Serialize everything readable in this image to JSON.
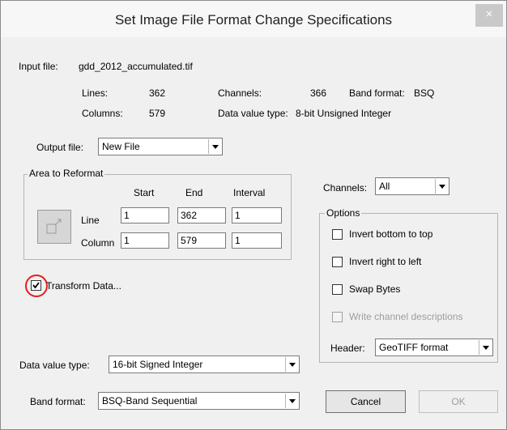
{
  "window": {
    "title": "Set Image File Format Change Specifications",
    "close_glyph": "×"
  },
  "input_file": {
    "label": "Input file:",
    "value": "gdd_2012_accumulated.tif"
  },
  "info": {
    "lines_label": "Lines:",
    "lines_value": "362",
    "columns_label": "Columns:",
    "columns_value": "579",
    "channels_label": "Channels:",
    "channels_value": "366",
    "band_format_label": "Band format:",
    "band_format_value": "BSQ",
    "data_value_type_label": "Data value type:",
    "data_value_type_value": "8-bit Unsigned Integer"
  },
  "output_file": {
    "label": "Output file:",
    "selected": "New File"
  },
  "area": {
    "group_label": "Area to Reformat",
    "col_start": "Start",
    "col_end": "End",
    "col_interval": "Interval",
    "line_label": "Line",
    "line_start": "1",
    "line_end": "362",
    "line_interval": "1",
    "column_label": "Column",
    "column_start": "1",
    "column_end": "579",
    "column_interval": "1"
  },
  "transform": {
    "label": "Transform Data...",
    "checked": true,
    "highlight_color": "#e02020"
  },
  "channels": {
    "label": "Channels:",
    "selected": "All"
  },
  "options": {
    "group_label": "Options",
    "invert_bottom_to_top": {
      "label": "Invert bottom to top",
      "checked": false
    },
    "invert_right_to_left": {
      "label": "Invert right to left",
      "checked": false
    },
    "swap_bytes": {
      "label": "Swap Bytes",
      "checked": false
    },
    "write_channel_descriptions": {
      "label": "Write channel descriptions",
      "checked": false,
      "enabled": false
    },
    "header_label": "Header:",
    "header_selected": "GeoTIFF format"
  },
  "data_value_type": {
    "label": "Data value type:",
    "selected": "16-bit Signed Integer"
  },
  "band_format": {
    "label": "Band format:",
    "selected": "BSQ-Band Sequential"
  },
  "buttons": {
    "cancel": "Cancel",
    "ok": "OK"
  }
}
